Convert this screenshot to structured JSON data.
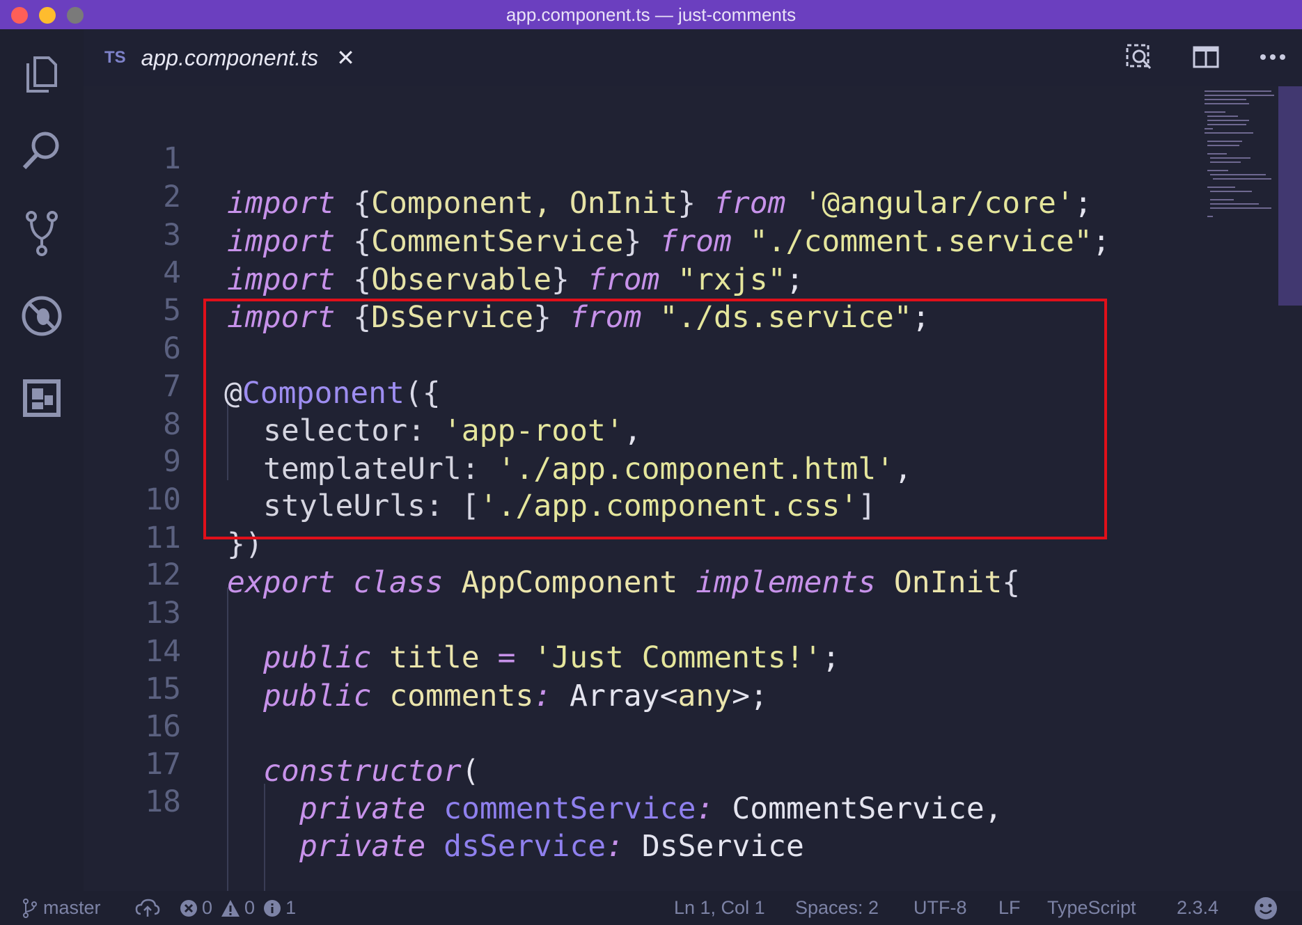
{
  "window": {
    "title": "app.component.ts — just-comments"
  },
  "activity_bar": {
    "items": [
      "explorer-icon",
      "search-icon",
      "source-control-icon",
      "debug-icon",
      "extensions-icon"
    ]
  },
  "tabs": [
    {
      "lang": "TS",
      "label": "app.component.ts",
      "close": "✕"
    }
  ],
  "editor_actions": [
    "open-preview-icon",
    "split-editor-icon",
    "more-actions-icon"
  ],
  "editor": {
    "line_numbers": [
      "1",
      "2",
      "3",
      "4",
      "5",
      "6",
      "7",
      "8",
      "9",
      "10",
      "11",
      "12",
      "13",
      "14",
      "15",
      "16",
      "17",
      "18"
    ],
    "code": {
      "l1": {
        "kw": "import",
        "ob": "{",
        "name": "Component, OnInit",
        "cb": "}",
        "from": "from",
        "str": "'@angular/core'",
        "end": ";"
      },
      "l2": {
        "kw": "import",
        "ob": "{",
        "name": "CommentService",
        "cb": "}",
        "from": "from",
        "str": "\"./comment.service\"",
        "end": ";"
      },
      "l3": {
        "kw": "import",
        "ob": "{",
        "name": "Observable",
        "cb": "}",
        "from": "from",
        "str": "\"rxjs\"",
        "end": ";"
      },
      "l4": {
        "kw": "import",
        "ob": "{",
        "name": "DsService",
        "cb": "}",
        "from": "from",
        "str": "\"./ds.service\"",
        "end": ";"
      },
      "l6": {
        "at": "@",
        "dec": "Component",
        "open": "({"
      },
      "l7": {
        "prop": "selector:",
        "str": "'app-root'",
        "end": ","
      },
      "l8": {
        "prop": "templateUrl:",
        "str": "'./app.component.html'",
        "end": ","
      },
      "l9": {
        "prop": "styleUrls:",
        "ob": "[",
        "str": "'./app.component.css'",
        "cb": "]"
      },
      "l10": {
        "close": "})"
      },
      "l11": {
        "kw": "export",
        "kw2": "class",
        "name": "AppComponent",
        "kw3": "implements",
        "iface": "OnInit",
        "ob": "{"
      },
      "l13": {
        "kw": "public",
        "name": "title",
        "op": "=",
        "str": "'Just Comments!'",
        "end": ";"
      },
      "l14": {
        "kw": "public",
        "name": "comments",
        "colon": ":",
        "type": "Array<",
        "any": "any",
        "tend": ">;"
      },
      "l16": {
        "kw": "constructor",
        "open": "("
      },
      "l17": {
        "kw": "private",
        "name": "commentService",
        "colon": ":",
        "type": "CommentService",
        "end": ","
      },
      "l18": {
        "kw": "private",
        "name": "dsService",
        "colon": ":",
        "type": "DsService"
      }
    }
  },
  "status_bar": {
    "branch": "master",
    "errors": "0",
    "warnings": "0",
    "info": "1",
    "position": "Ln 1, Col 1",
    "spaces": "Spaces: 2",
    "encoding": "UTF-8",
    "eol": "LF",
    "language": "TypeScript",
    "version": "2.3.4"
  },
  "colors": {
    "titlebar": "#6b3fbf",
    "editor_bg": "#202233",
    "keyword": "#c792ea",
    "string": "#e5e69c",
    "highlight_box": "#e0101a"
  }
}
